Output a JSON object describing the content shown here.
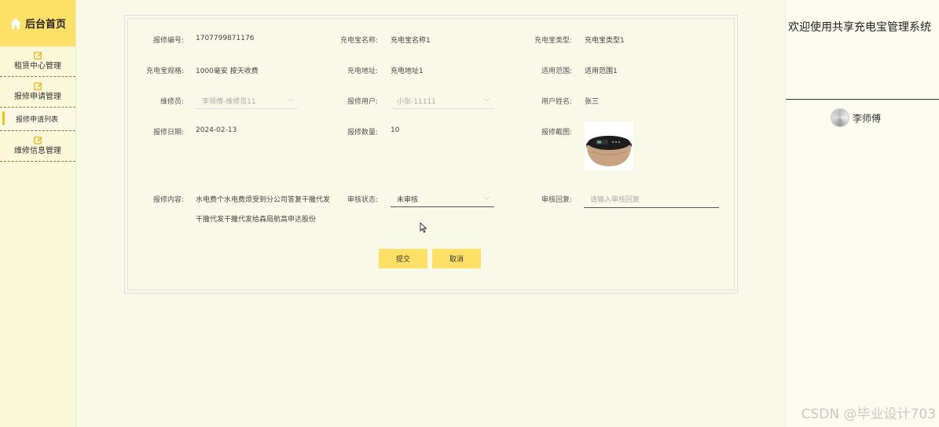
{
  "sidebar": {
    "home_label": "后台首页",
    "groups": [
      {
        "label": "租赁中心管理"
      },
      {
        "label": "报修申请管理"
      },
      {
        "label": "维修信息管理"
      }
    ],
    "submenu": {
      "label": "报修申请列表"
    }
  },
  "header": {
    "welcome": "欢迎使用共享充电宝管理系统",
    "user": "李师傅"
  },
  "form": {
    "labels": {
      "repair_no": "报修编号:",
      "powerbank_name": "充电宝名称:",
      "powerbank_type": "充电宝类型:",
      "powerbank_spec": "充电宝规格:",
      "powerbank_address": "充电地址:",
      "scope": "适用范围:",
      "repairman": "维修员:",
      "report_user": "报修用户:",
      "user_name": "用户姓名:",
      "repair_date": "报修日期:",
      "repair_qty": "报修数量:",
      "repair_photo": "报修截图:",
      "repair_content": "报修内容:",
      "audit_status": "审核状态:",
      "audit_reply": "审核回复:"
    },
    "values": {
      "repair_no": "1707799871176",
      "powerbank_name": "充电宝名称1",
      "powerbank_type": "充电宝类型1",
      "powerbank_spec": "1000毫安 按天收费",
      "powerbank_address": "充电地址1",
      "scope": "适用范围1",
      "repairman": "李师傅-维修员11",
      "report_user": "小张-11111",
      "user_name": "张三",
      "repair_date": "2024-02-13",
      "repair_qty": "10",
      "repair_content_line1": "水电费个水电费烦受到分公司答复干撒代发",
      "repair_content_line2": "干撒代发干撒代发给森局航高申达股份",
      "audit_status": "未审核",
      "audit_reply_placeholder": "请输入审核回复"
    },
    "buttons": {
      "submit": "提交",
      "cancel": "取消"
    }
  },
  "watermark": "CSDN @毕业设计703"
}
